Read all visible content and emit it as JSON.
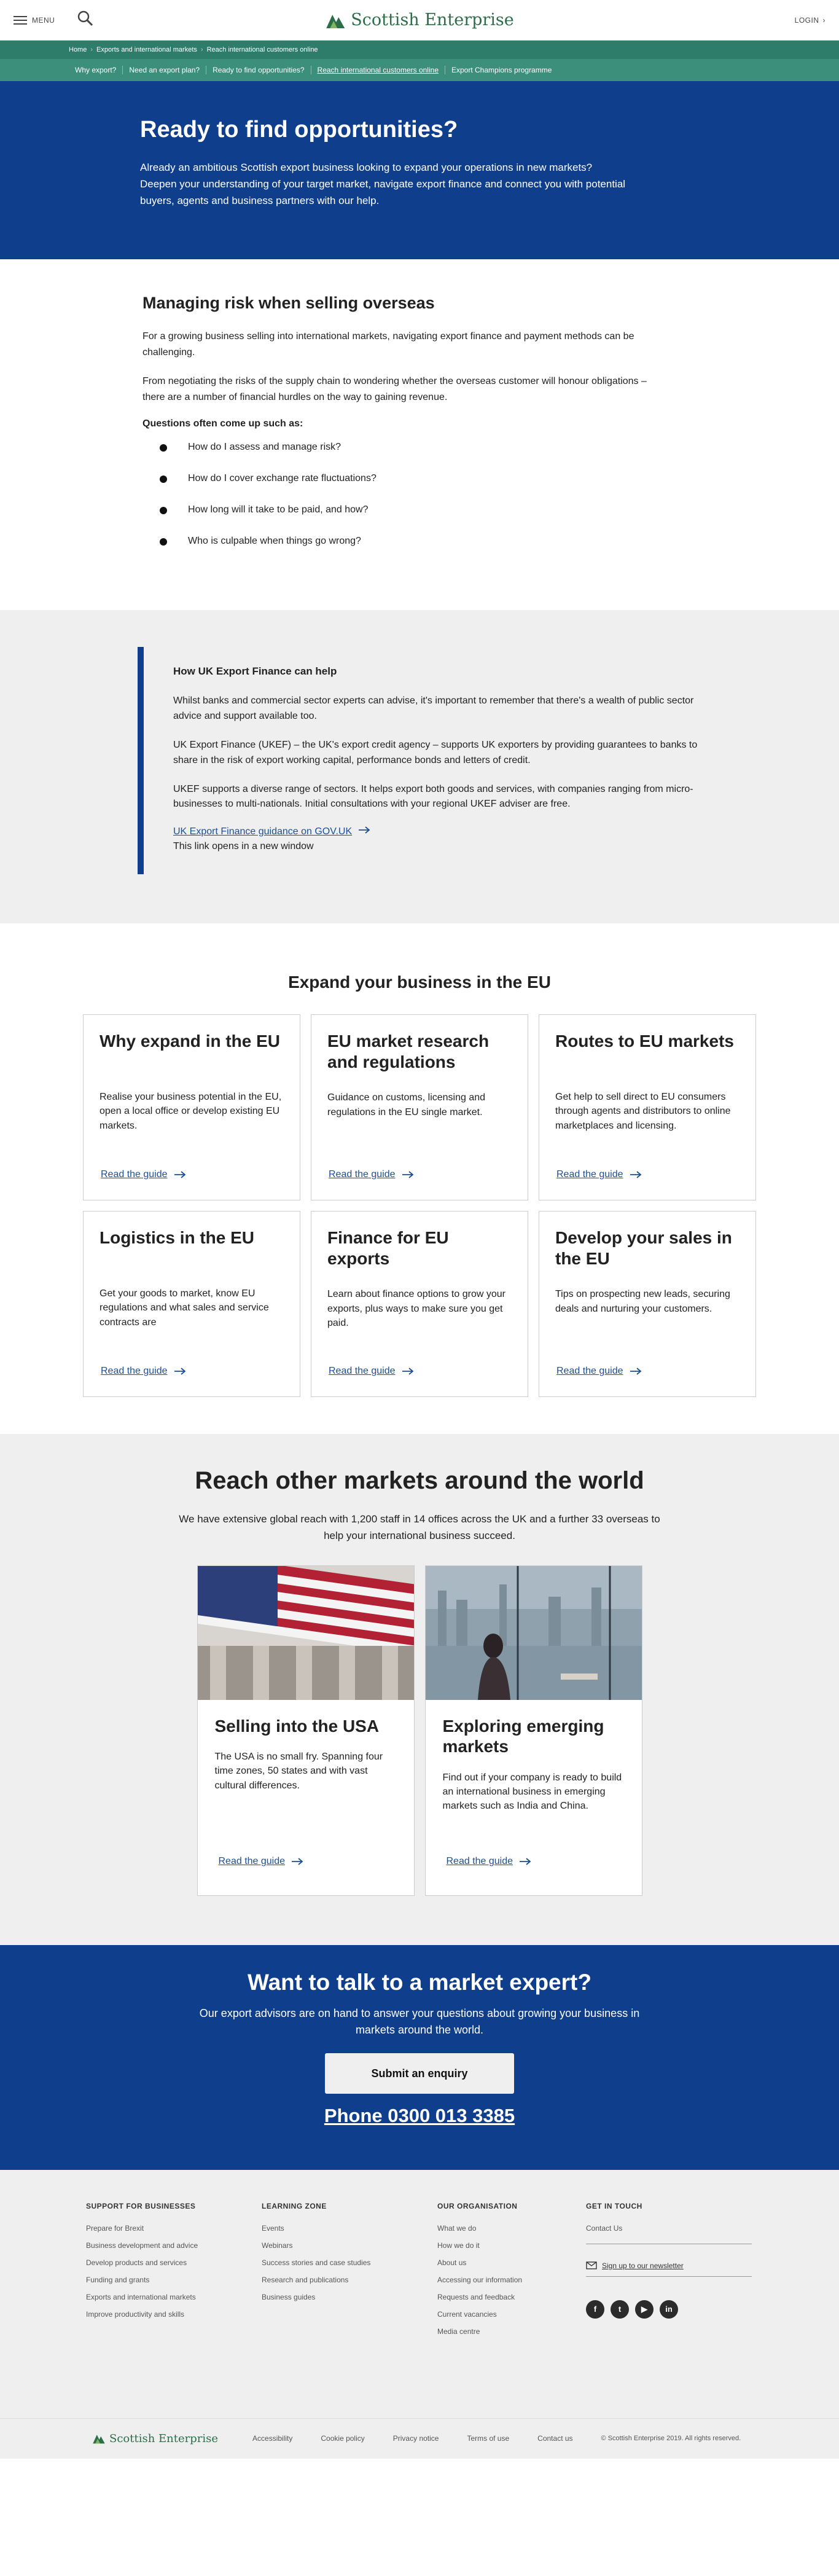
{
  "header": {
    "menu_label": "MENU",
    "logo_text": "Scottish Enterprise",
    "login_label": "LOGIN"
  },
  "breadcrumb": [
    "Home",
    "Exports and international markets",
    "Reach international customers online"
  ],
  "subnav": [
    "Why export?",
    "Need an export plan?",
    "Ready to find opportunities?",
    "Reach international customers online",
    "Export Champions programme"
  ],
  "hero": {
    "title": "Ready to find opportunities?",
    "text": "Already an ambitious Scottish export business looking to expand your operations in new markets? Deepen your understanding of your target market, navigate export finance and connect you with potential buyers, agents and business partners with our help."
  },
  "risk": {
    "title": "Managing risk when selling overseas",
    "p1": "For a growing business selling into international markets, navigating export finance and payment methods can be challenging.",
    "p2": "From negotiating the risks of the supply chain to wondering whether the overseas customer will honour obligations – there are a number of financial hurdles on the way to gaining revenue.",
    "subtitle": "Questions often come up such as:",
    "questions": [
      "How do I assess and manage risk?",
      "How do I cover exchange rate fluctuations?",
      "How long will it take to be paid, and how?",
      "Who is culpable when things go wrong?"
    ]
  },
  "ukef": {
    "title": "How UK Export Finance can help",
    "p1": "Whilst banks and commercial sector experts can advise, it's important to remember that there's a wealth of public sector advice and support available too.",
    "p2": "UK Export Finance (UKEF) – the UK's export credit agency – supports UK exporters by providing guarantees to banks to share in the risk of export working capital, performance bonds and letters of credit.",
    "p3": "UKEF supports a diverse range of sectors. It helps export both goods and services, with companies ranging from micro-businesses to multi-nationals. Initial consultations with your regional UKEF adviser are free.",
    "link": "UK Export Finance guidance on GOV.UK",
    "note": "This link opens in a new window"
  },
  "eu": {
    "title": "Expand your business in the EU",
    "read_label": "Read the guide",
    "cards": [
      {
        "title": "Why expand in the EU",
        "text": "Realise your business potential in the EU, open a local office or develop existing EU markets."
      },
      {
        "title": "EU market research and regulations",
        "text": "Guidance on customs, licensing and regulations in the EU single market."
      },
      {
        "title": "Routes to EU markets",
        "text": "Get help to sell direct to EU consumers through agents and distributors to online marketplaces and licensing."
      },
      {
        "title": "Logistics in the EU",
        "text": "Get your goods to market, know EU regulations and what sales and service contracts are"
      },
      {
        "title": "Finance for EU exports",
        "text": "Learn about finance options to grow your exports, plus ways to make sure you get paid."
      },
      {
        "title": "Develop your sales in the EU",
        "text": "Tips on prospecting new leads, securing deals and nurturing your customers."
      }
    ]
  },
  "reach": {
    "title": "Reach other markets around the world",
    "lead": "We have extensive global reach with 1,200 staff in 14 offices across the UK and a further 33 overseas to help your international business succeed.",
    "read_label": "Read the guide",
    "cards": [
      {
        "title": "Selling into the USA",
        "text": "The USA is no small fry. Spanning four time zones, 50 states and with vast cultural differences."
      },
      {
        "title": "Exploring emerging markets",
        "text": "Find out if your company is ready to build an international business in emerging markets such as India and China."
      }
    ]
  },
  "cta": {
    "title": "Want to talk to a market expert?",
    "text": "Our export advisors are on hand to answer your questions about growing your business in markets around the world.",
    "button": "Submit an enquiry",
    "phone": "Phone 0300 013 3385"
  },
  "footer": {
    "cols": [
      {
        "title": "SUPPORT FOR BUSINESSES",
        "links": [
          "Prepare for Brexit",
          "Business development and advice",
          "Develop products and services",
          "Funding and grants",
          "Exports and international markets",
          "Improve productivity and skills"
        ]
      },
      {
        "title": "LEARNING ZONE",
        "links": [
          "Events",
          "Webinars",
          "Success stories and case studies",
          "Research and publications",
          "Business guides"
        ]
      },
      {
        "title": "OUR ORGANISATION",
        "links": [
          "What we do",
          "How we do it",
          "About us",
          "Accessing our information",
          "Requests and feedback",
          "Current vacancies",
          "Media centre"
        ]
      },
      {
        "title": "GET IN TOUCH",
        "links": [
          "Contact Us"
        ]
      }
    ],
    "newsletter": "Sign up to our newsletter",
    "social": [
      "f",
      "t",
      "▶",
      "in"
    ],
    "bottom_logo": "Scottish Enterprise",
    "bottom_links": [
      "Accessibility",
      "Cookie policy",
      "Privacy notice",
      "Terms of use",
      "Contact us",
      "© Scottish Enterprise 2019. All rights reserved."
    ]
  }
}
